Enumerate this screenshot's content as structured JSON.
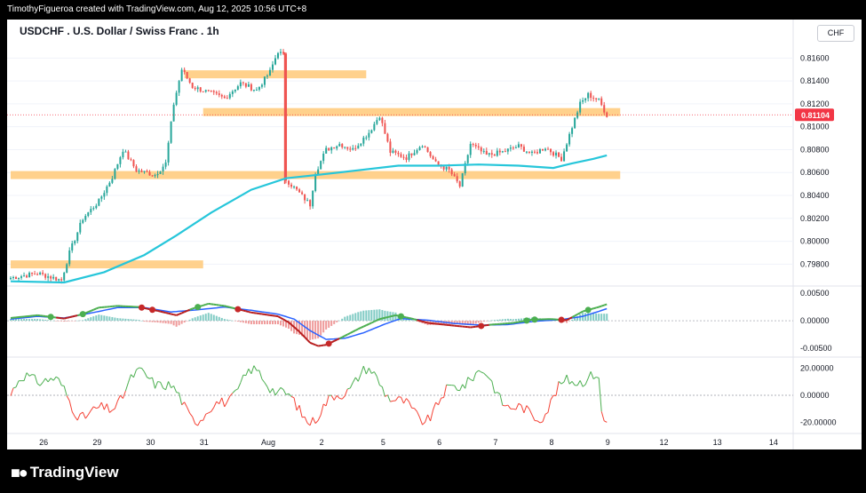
{
  "header": {
    "attribution": "TimothyFigueroa created with TradingView.com, Aug 12, 2025 10:56 UTC+8"
  },
  "chart_title": "USDCHF . U.S. Dollar / Swiss Franc . 1h",
  "currency": "CHF",
  "brand": {
    "logo_icon": "tradingview-logo-icon",
    "name": "TradingView"
  },
  "colors": {
    "up": "#26a69a",
    "down": "#ef5350",
    "ma": "#26c6da",
    "zone": "#ffcc80",
    "last_price": "#f23645",
    "macd_line": "#4caf50",
    "macd_signal": "#2962ff",
    "osc_up": "#4caf50",
    "osc_down": "#f44336"
  },
  "chart_data": [
    {
      "type": "candlestick",
      "name": "price",
      "y_ticks": [
        "0.81600",
        "0.81400",
        "0.81200",
        "0.81000",
        "0.80800",
        "0.80600",
        "0.80400",
        "0.80200",
        "0.80000",
        "0.79800"
      ],
      "ylim": [
        0.7964,
        0.8175
      ],
      "last_price": "0.81104",
      "x_ticks": [
        "26",
        "29",
        "30",
        "31",
        "Aug",
        "2",
        "5",
        "6",
        "7",
        "8",
        "9",
        "12",
        "13",
        "14"
      ],
      "xlim": [
        0,
        200
      ],
      "anchors": [
        [
          0,
          0.7968
        ],
        [
          10,
          0.7972
        ],
        [
          19,
          0.7966
        ],
        [
          22,
          0.799
        ],
        [
          27,
          0.802
        ],
        [
          33,
          0.8035
        ],
        [
          38,
          0.8056
        ],
        [
          42,
          0.808
        ],
        [
          47,
          0.8062
        ],
        [
          54,
          0.8058
        ],
        [
          58,
          0.8068
        ],
        [
          61,
          0.812
        ],
        [
          64,
          0.815
        ],
        [
          68,
          0.8135
        ],
        [
          74,
          0.813
        ],
        [
          80,
          0.8125
        ],
        [
          86,
          0.8138
        ],
        [
          92,
          0.8132
        ],
        [
          97,
          0.8148
        ],
        [
          100,
          0.8166
        ],
        [
          102,
          0.8162
        ],
        [
          103,
          0.8054
        ],
        [
          108,
          0.8042
        ],
        [
          112,
          0.8032
        ],
        [
          114,
          0.806
        ],
        [
          118,
          0.808
        ],
        [
          123,
          0.8085
        ],
        [
          128,
          0.808
        ],
        [
          134,
          0.8095
        ],
        [
          138,
          0.811
        ],
        [
          142,
          0.8078
        ],
        [
          148,
          0.8073
        ],
        [
          154,
          0.8085
        ],
        [
          159,
          0.8068
        ],
        [
          164,
          0.8062
        ],
        [
          168,
          0.8048
        ],
        [
          172,
          0.8085
        ],
        [
          178,
          0.8075
        ],
        [
          184,
          0.8078
        ],
        [
          190,
          0.8083
        ],
        [
          195,
          0.8076
        ],
        [
          200,
          0.8082
        ],
        [
          206,
          0.8072
        ],
        [
          210,
          0.81
        ],
        [
          213,
          0.812
        ],
        [
          216,
          0.8128
        ],
        [
          220,
          0.8123
        ],
        [
          223,
          0.811
        ]
      ],
      "moving_average": [
        [
          0,
          0.7965
        ],
        [
          20,
          0.7964
        ],
        [
          35,
          0.7973
        ],
        [
          50,
          0.7988
        ],
        [
          62,
          0.8005
        ],
        [
          75,
          0.8025
        ],
        [
          90,
          0.8045
        ],
        [
          103,
          0.8055
        ],
        [
          115,
          0.8058
        ],
        [
          130,
          0.8062
        ],
        [
          145,
          0.8066
        ],
        [
          160,
          0.8066
        ],
        [
          175,
          0.8067
        ],
        [
          190,
          0.8066
        ],
        [
          203,
          0.8064
        ],
        [
          210,
          0.8068
        ],
        [
          218,
          0.8072
        ],
        [
          223,
          0.8075
        ]
      ],
      "zones": [
        [
          65,
          133,
          0.81458
        ],
        [
          72,
          228,
          0.81128
        ],
        [
          0,
          228,
          0.80578
        ],
        [
          0,
          72,
          0.79798
        ]
      ]
    },
    {
      "type": "line",
      "name": "macd",
      "y_ticks": [
        "0.00500",
        "0.00000",
        "-0.00500"
      ],
      "ylim": [
        -0.0063,
        0.006
      ],
      "macd_line": [
        [
          0,
          0.0005
        ],
        [
          10,
          0.001
        ],
        [
          15,
          0.0007
        ],
        [
          20,
          0.0004
        ],
        [
          27,
          0.0012
        ],
        [
          33,
          0.0024
        ],
        [
          40,
          0.0027
        ],
        [
          48,
          0.0025
        ],
        [
          55,
          0.0018
        ],
        [
          62,
          0.001
        ],
        [
          68,
          0.0022
        ],
        [
          74,
          0.0031
        ],
        [
          80,
          0.0027
        ],
        [
          90,
          0.0015
        ],
        [
          100,
          0.0008
        ],
        [
          104,
          -0.0003
        ],
        [
          108,
          -0.002
        ],
        [
          112,
          -0.004
        ],
        [
          115,
          -0.0046
        ],
        [
          118,
          -0.0044
        ],
        [
          124,
          -0.003
        ],
        [
          130,
          -0.0015
        ],
        [
          138,
          0.0003
        ],
        [
          144,
          0.001
        ],
        [
          150,
          0.0004
        ],
        [
          156,
          -0.0004
        ],
        [
          164,
          -0.0008
        ],
        [
          172,
          -0.0012
        ],
        [
          180,
          -0.0007
        ],
        [
          188,
          -0.0004
        ],
        [
          195,
          0.0002
        ],
        [
          202,
          0.0003
        ],
        [
          208,
          0.0001
        ],
        [
          214,
          0.0017
        ],
        [
          220,
          0.0025
        ],
        [
          223,
          0.003
        ]
      ],
      "signal_line": [
        [
          0,
          0.0003
        ],
        [
          10,
          0.0008
        ],
        [
          20,
          0.0005
        ],
        [
          30,
          0.0014
        ],
        [
          40,
          0.0024
        ],
        [
          50,
          0.0024
        ],
        [
          60,
          0.0016
        ],
        [
          70,
          0.002
        ],
        [
          80,
          0.0025
        ],
        [
          90,
          0.0019
        ],
        [
          100,
          0.0012
        ],
        [
          106,
          0.0003
        ],
        [
          112,
          -0.0018
        ],
        [
          118,
          -0.0034
        ],
        [
          125,
          -0.0032
        ],
        [
          132,
          -0.0022
        ],
        [
          140,
          -0.0006
        ],
        [
          146,
          0.0004
        ],
        [
          156,
          0.0001
        ],
        [
          166,
          -0.0005
        ],
        [
          176,
          -0.0008
        ],
        [
          186,
          -0.0007
        ],
        [
          196,
          -0.0001
        ],
        [
          206,
          0.0002
        ],
        [
          214,
          0.0008
        ],
        [
          220,
          0.0017
        ],
        [
          223,
          0.0022
        ]
      ],
      "cross_points": [
        [
          15,
          0.0007
        ],
        [
          27,
          0.0012
        ],
        [
          49,
          0.0025
        ],
        [
          53,
          0.0024
        ],
        [
          70,
          0.0007
        ],
        [
          85,
          0.0028
        ],
        [
          119,
          -0.0044
        ],
        [
          146,
          0.0008
        ],
        [
          176,
          -0.001
        ],
        [
          193,
          0.0003
        ],
        [
          196,
          0.0003
        ],
        [
          206,
          0.0005
        ],
        [
          216,
          0.0004
        ]
      ]
    },
    {
      "type": "line",
      "name": "oscillator",
      "y_ticks": [
        "20.00000",
        "0.00000",
        "-20.00000"
      ],
      "ylim": [
        -27,
        27
      ]
    }
  ]
}
